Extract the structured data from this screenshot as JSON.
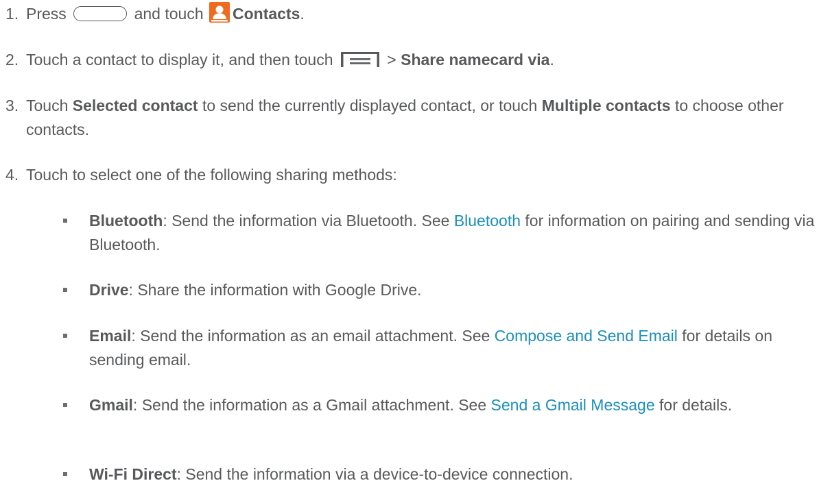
{
  "steps": [
    {
      "number": "1.",
      "press": "Press",
      "and_touch": "and touch",
      "contacts": "Contacts",
      "end": "."
    },
    {
      "number": "2.",
      "text": "Touch a contact to display it, and then touch",
      "arrow": ">",
      "share": "Share namecard via",
      "end": "."
    },
    {
      "number": "3.",
      "touch": "Touch",
      "selected": "Selected contact",
      "mid": "to send the currently displayed contact, or touch",
      "multiple": "Multiple contacts",
      "end": "to choose other contacts."
    },
    {
      "number": "4.",
      "text": "Touch to select one of the following sharing methods:"
    }
  ],
  "methods": [
    {
      "name": "Bluetooth",
      "desc": ": Send the information via Bluetooth. See",
      "link": "Bluetooth",
      "after": "for information on pairing and sending via Bluetooth."
    },
    {
      "name": "Drive",
      "desc": ": Share the information with Google Drive."
    },
    {
      "name": "Email",
      "desc": ": Send the information as an email attachment. See",
      "link": "Compose and Send Email",
      "after": "for details on sending email."
    },
    {
      "name": "Gmail",
      "desc": ": Send the information as a Gmail attachment. See",
      "link": "Send a Gmail Message",
      "after": "for details."
    },
    {
      "name": "Wi-Fi Direct",
      "desc": ": Send the information via a device-to-device connection."
    }
  ],
  "icons": {
    "home_key": "home-key-icon",
    "contacts": "contacts-app-icon",
    "menu": "menu-key-icon"
  },
  "colors": {
    "text": "#58595b",
    "link": "#1a8fbc",
    "contacts_icon": "#ee6b1f"
  }
}
